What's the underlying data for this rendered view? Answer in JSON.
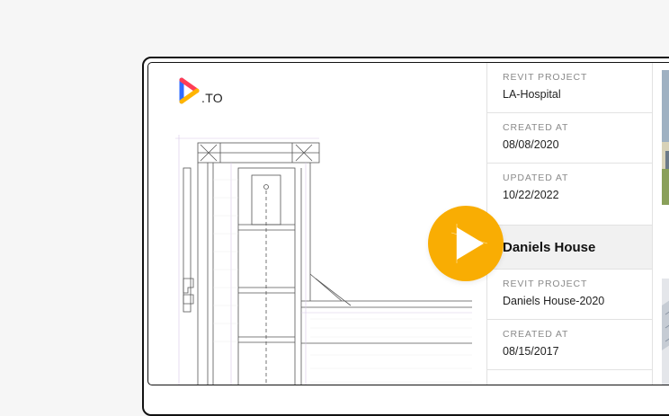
{
  "logo": {
    "text": ".TO"
  },
  "project1": {
    "fields": [
      {
        "label": "REVIT PROJECT",
        "value": "LA-Hospital"
      },
      {
        "label": "CREATED AT",
        "value": "08/08/2020"
      },
      {
        "label": "UPDATED AT",
        "value": "10/22/2022"
      }
    ]
  },
  "project2": {
    "name": "Daniels House",
    "fields": [
      {
        "label": "REVIT PROJECT",
        "value": "Daniels House-2020"
      },
      {
        "label": "CREATED AT",
        "value": "08/15/2017"
      }
    ]
  },
  "colors": {
    "accent": "#f9ad03",
    "logo_blue": "#2f6bff",
    "logo_red": "#ff3d55",
    "logo_yellow": "#ffb400"
  },
  "icons": {
    "play": "play-icon",
    "logo": "logo-icon"
  }
}
